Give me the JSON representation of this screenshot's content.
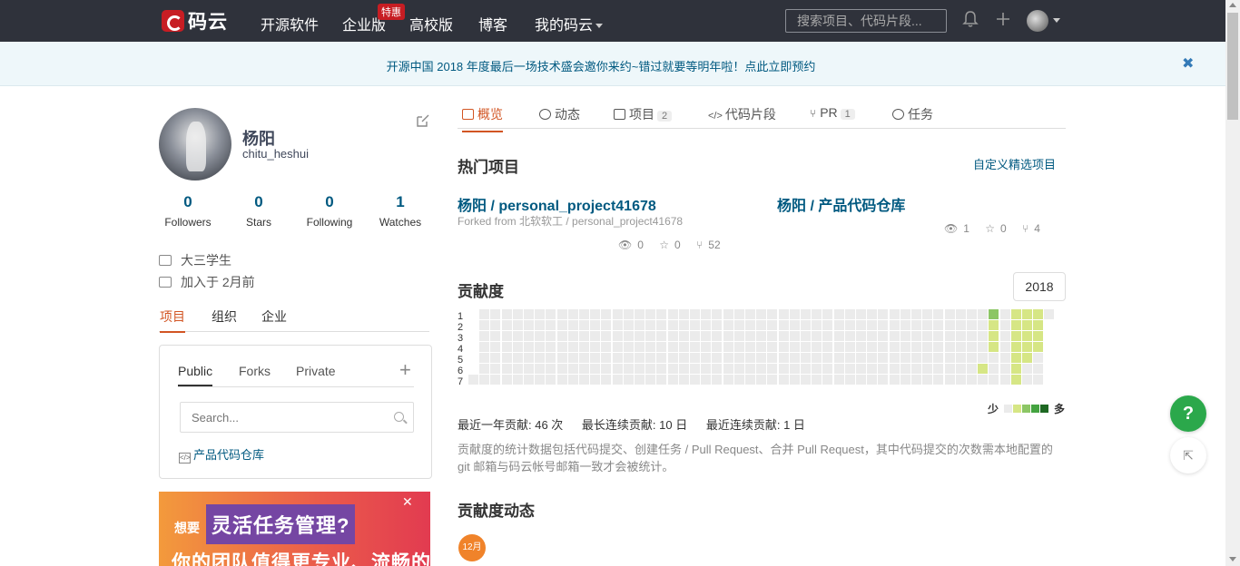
{
  "nav": {
    "logo_text": "码云",
    "items": [
      {
        "label": "开源软件"
      },
      {
        "label": "企业版"
      },
      {
        "label": "高校版"
      },
      {
        "label": "博客"
      },
      {
        "label": "我的码云"
      }
    ],
    "hot_badge": "特惠",
    "search_placeholder": "搜索项目、代码片段...",
    "icons": [
      "bell-icon",
      "plus-icon",
      "avatar"
    ]
  },
  "announcement": {
    "text": "开源中国 2018 年度最后一场技术盛会邀你来约~错过就要等明年啦！点此立即预约",
    "close": "✖"
  },
  "profile": {
    "name": "杨阳",
    "login": "chitu_heshui",
    "stats": [
      {
        "num": "0",
        "label": "Followers"
      },
      {
        "num": "0",
        "label": "Stars"
      },
      {
        "num": "0",
        "label": "Following"
      },
      {
        "num": "1",
        "label": "Watches"
      }
    ],
    "bio": "大三学生",
    "joined": "加入于 2月前",
    "tabs": [
      "项目",
      "组织",
      "企业"
    ]
  },
  "repo_panel": {
    "tabs": [
      "Public",
      "Forks",
      "Private"
    ],
    "add": "+",
    "search_placeholder": "Search...",
    "repos": [
      "产品代码仓库"
    ]
  },
  "promo": {
    "small": "想要",
    "big": "灵活任务管理?",
    "line2": "你的团队值得更专业、流畅的",
    "close": "✕"
  },
  "main_tabs": [
    {
      "label": "概览",
      "count": ""
    },
    {
      "label": "动态",
      "count": ""
    },
    {
      "label": "项目",
      "count": "2"
    },
    {
      "label": "代码片段",
      "count": ""
    },
    {
      "label": "PR",
      "count": "1"
    },
    {
      "label": "任务",
      "count": ""
    }
  ],
  "hot_projects": {
    "title": "热门项目",
    "customize": "自定义精选项目",
    "items": [
      {
        "title": "杨阳 / personal_project41678",
        "fork_from": "Forked from 北软软工  / personal_project41678",
        "watch": "0",
        "star": "0",
        "fork": "52"
      },
      {
        "title": "杨阳 / 产品代码仓库",
        "fork_from": "",
        "watch": "1",
        "star": "0",
        "fork": "4"
      }
    ]
  },
  "contribution": {
    "title": "贡献度",
    "year": "2018",
    "day_labels": [
      "1",
      "2",
      "3",
      "4",
      "5",
      "6",
      "7"
    ],
    "legend_less": "少",
    "legend_more": "多",
    "legend_colors": [
      "#ebebeb",
      "#d6e685",
      "#8cc665",
      "#44a340",
      "#1e6823"
    ],
    "summary": [
      "最近一年贡献: 46 次",
      "最长连续贡献: 10 日",
      "最近连续贡献: 1 日"
    ],
    "note": "贡献度的统计数据包括代码提交、创建任务 / Pull Request、合并 Pull Request，其中代码提交的次数需本地配置的 git 邮箱与码云帐号邮箱一致才会被统计。",
    "active_cells": [
      {
        "w": 47,
        "d": 0,
        "level": 2
      },
      {
        "w": 47,
        "d": 1,
        "level": 1
      },
      {
        "w": 47,
        "d": 2,
        "level": 1
      },
      {
        "w": 47,
        "d": 3,
        "level": 1
      },
      {
        "w": 46,
        "d": 5,
        "level": 1
      },
      {
        "w": 49,
        "d": 0,
        "level": 1
      },
      {
        "w": 49,
        "d": 1,
        "level": 1
      },
      {
        "w": 49,
        "d": 2,
        "level": 1
      },
      {
        "w": 49,
        "d": 3,
        "level": 1
      },
      {
        "w": 49,
        "d": 4,
        "level": 1
      },
      {
        "w": 49,
        "d": 5,
        "level": 1
      },
      {
        "w": 49,
        "d": 6,
        "level": 1
      },
      {
        "w": 50,
        "d": 0,
        "level": 1
      },
      {
        "w": 50,
        "d": 1,
        "level": 1
      },
      {
        "w": 50,
        "d": 2,
        "level": 1
      },
      {
        "w": 50,
        "d": 3,
        "level": 1
      },
      {
        "w": 50,
        "d": 4,
        "level": 1
      },
      {
        "w": 51,
        "d": 0,
        "level": 1
      },
      {
        "w": 51,
        "d": 1,
        "level": 1
      },
      {
        "w": 51,
        "d": 2,
        "level": 1
      },
      {
        "w": 51,
        "d": 3,
        "level": 1
      },
      {
        "w": 52,
        "d": 2,
        "level": 1
      }
    ]
  },
  "activity": {
    "title": "贡献度动态",
    "month": "12月"
  },
  "floating": {
    "help": "?",
    "share": "⇱"
  }
}
